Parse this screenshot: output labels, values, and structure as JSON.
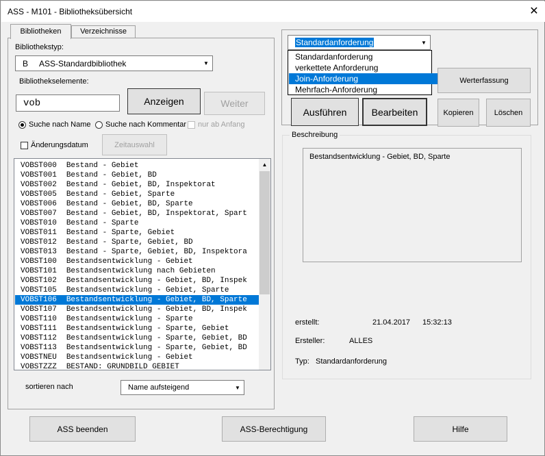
{
  "window": {
    "title": "ASS - M101 - Bibliotheksübersicht",
    "close_glyph": "✕"
  },
  "tabs": [
    {
      "label": "Bibliotheken"
    },
    {
      "label": "Verzeichnisse"
    }
  ],
  "bibliothekstyp": {
    "label": "Bibliothekstyp:",
    "value_code": "B",
    "value_name": "ASS-Standardbibliothek"
  },
  "elements": {
    "label": "Bibliothekselemente:",
    "search_value": "vob"
  },
  "buttons": {
    "anzeigen": "Anzeigen",
    "weiter": "Weiter",
    "zeitauswahl": "Zeitauswahl",
    "ausfuehren": "Ausführen",
    "bearbeiten": "Bearbeiten",
    "werterfassung": "Werterfassung",
    "kopieren": "Kopieren",
    "loeschen": "Löschen",
    "ass_beenden": "ASS beenden",
    "ass_berechtigung": "ASS-Berechtigung",
    "hilfe": "Hilfe"
  },
  "search_options": {
    "by_name": "Suche nach Name",
    "by_comment": "Suche nach Kommentar",
    "from_start": "nur ab Anfang",
    "change_date": "Änderungsdatum"
  },
  "list": {
    "selected_index": 14,
    "items": [
      {
        "code": "VOBST000",
        "text": "Bestand - Gebiet"
      },
      {
        "code": "VOBST001",
        "text": "Bestand - Gebiet, BD"
      },
      {
        "code": "VOBST002",
        "text": "Bestand - Gebiet, BD, Inspektorat"
      },
      {
        "code": "VOBST005",
        "text": "Bestand - Gebiet, Sparte"
      },
      {
        "code": "VOBST006",
        "text": "Bestand - Gebiet, BD, Sparte"
      },
      {
        "code": "VOBST007",
        "text": "Bestand - Gebiet, BD, Inspektorat, Spart"
      },
      {
        "code": "VOBST010",
        "text": "Bestand - Sparte"
      },
      {
        "code": "VOBST011",
        "text": "Bestand - Sparte, Gebiet"
      },
      {
        "code": "VOBST012",
        "text": "Bestand - Sparte, Gebiet, BD"
      },
      {
        "code": "VOBST013",
        "text": "Bestand - Sparte, Gebiet, BD, Inspektora"
      },
      {
        "code": "VOBST100",
        "text": "Bestandsentwicklung - Gebiet"
      },
      {
        "code": "VOBST101",
        "text": "Bestandsentwicklung nach Gebieten"
      },
      {
        "code": "VOBST102",
        "text": "Bestandsentwicklung - Gebiet, BD, Inspek"
      },
      {
        "code": "VOBST105",
        "text": "Bestandsentwicklung - Gebiet, Sparte"
      },
      {
        "code": "VOBST106",
        "text": "Bestandsentwicklung - Gebiet, BD, Sparte"
      },
      {
        "code": "VOBST107",
        "text": "Bestandsentwicklung - Gebiet, BD, Inspek"
      },
      {
        "code": "VOBST110",
        "text": "Bestandsentwicklung - Sparte"
      },
      {
        "code": "VOBST111",
        "text": "Bestandsentwicklung - Sparte, Gebiet"
      },
      {
        "code": "VOBST112",
        "text": "Bestandsentwicklung - Sparte, Gebiet, BD"
      },
      {
        "code": "VOBST113",
        "text": "Bestandsentwicklung - Sparte, Gebiet, BD"
      },
      {
        "code": "VOBSTNEU",
        "text": "Bestandsentwicklung - Gebiet"
      },
      {
        "code": "VOBSTZZZ",
        "text": "BESTAND: GRUNDBILD GEBIET"
      }
    ]
  },
  "sort": {
    "label": "sortieren nach",
    "value": "Name aufsteigend"
  },
  "request_type": {
    "value": "Standardanforderung",
    "options": [
      {
        "label": "Standardanforderung"
      },
      {
        "label": "verkettete Anforderung"
      },
      {
        "label": "Join-Anforderung"
      },
      {
        "label": "Mehrfach-Anforderung"
      }
    ],
    "highlighted_index": 2
  },
  "description": {
    "group_label": "Beschreibung",
    "text": "Bestandsentwicklung - Gebiet, BD, Sparte",
    "created_label": "erstellt:",
    "created_date": "21.04.2017",
    "created_time": "15:32:13",
    "creator_label": "Ersteller:",
    "creator": "ALLES",
    "type_label": "Typ:",
    "type": "Standardanforderung"
  }
}
